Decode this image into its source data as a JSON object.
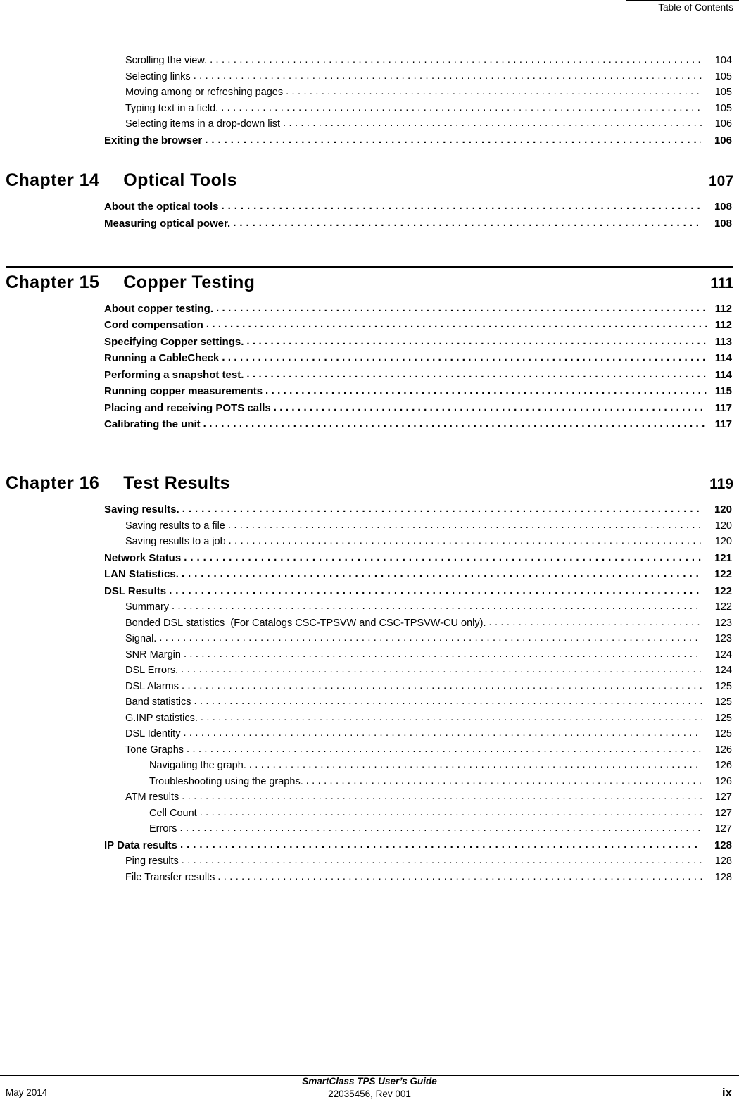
{
  "header": {
    "title": "Table of Contents"
  },
  "footer": {
    "date": "May 2014",
    "guide_title": "SmartClass TPS User’s Guide",
    "doc_number": "22035456, Rev 001",
    "page_number": "ix"
  },
  "toc": {
    "top_entries": [
      {
        "label": "Scrolling the view.",
        "page": "104",
        "level": "sub"
      },
      {
        "label": "Selecting links",
        "page": "105",
        "level": "sub"
      },
      {
        "label": "Moving among or refreshing pages",
        "page": "105",
        "level": "sub"
      },
      {
        "label": "Typing text in a field.",
        "page": "105",
        "level": "sub"
      },
      {
        "label": "Selecting items in a drop-down list",
        "page": "106",
        "level": "sub"
      },
      {
        "label": "Exiting the browser",
        "page": "106",
        "level": "section"
      }
    ],
    "chapters": [
      {
        "number": "Chapter 14",
        "title": "Optical Tools",
        "page": "107",
        "tight": false,
        "entries": [
          {
            "label": "About the optical tools",
            "page": "108",
            "level": "section"
          },
          {
            "label": "Measuring optical power.",
            "page": "108",
            "level": "section"
          }
        ]
      },
      {
        "number": "Chapter 15",
        "title": "Copper Testing",
        "page": "111",
        "tight": true,
        "entries": [
          {
            "label": "About copper testing.",
            "page": "112",
            "level": "section"
          },
          {
            "label": "Cord compensation",
            "page": "112",
            "level": "section"
          },
          {
            "label": "Specifying Copper settings.",
            "page": "113",
            "level": "section"
          },
          {
            "label": "Running a CableCheck",
            "page": "114",
            "level": "section"
          },
          {
            "label": "Performing a snapshot test.",
            "page": "114",
            "level": "section"
          },
          {
            "label": "Running copper measurements",
            "page": "115",
            "level": "section"
          },
          {
            "label": "Placing and receiving POTS calls",
            "page": "117",
            "level": "section"
          },
          {
            "label": "Calibrating the unit",
            "page": "117",
            "level": "section"
          }
        ]
      },
      {
        "number": "Chapter 16",
        "title": "Test Results",
        "page": "119",
        "tight": false,
        "entries": [
          {
            "label": "Saving results.",
            "page": "120",
            "level": "section"
          },
          {
            "label": "Saving results to a file",
            "page": "120",
            "level": "sub"
          },
          {
            "label": "Saving results to a job",
            "page": "120",
            "level": "sub"
          },
          {
            "label": "Network Status",
            "page": "121",
            "level": "section"
          },
          {
            "label": "LAN Statistics.",
            "page": "122",
            "level": "section"
          },
          {
            "label": "DSL Results",
            "page": "122",
            "level": "section"
          },
          {
            "label": "Summary",
            "page": "122",
            "level": "sub"
          },
          {
            "label": "Bonded DSL statistics  (For Catalogs CSC-TPSVW and CSC-TPSVW-CU only).",
            "page": "123",
            "level": "sub"
          },
          {
            "label": "Signal.",
            "page": "123",
            "level": "sub"
          },
          {
            "label": "SNR Margin",
            "page": "124",
            "level": "sub"
          },
          {
            "label": "DSL Errors.",
            "page": "124",
            "level": "sub"
          },
          {
            "label": "DSL Alarms",
            "page": "125",
            "level": "sub"
          },
          {
            "label": "Band statistics",
            "page": "125",
            "level": "sub"
          },
          {
            "label": "G.INP statistics.",
            "page": "125",
            "level": "sub"
          },
          {
            "label": "DSL Identity",
            "page": "125",
            "level": "sub"
          },
          {
            "label": "Tone Graphs",
            "page": "126",
            "level": "sub"
          },
          {
            "label": "Navigating the graph.",
            "page": "126",
            "level": "subsub"
          },
          {
            "label": "Troubleshooting using the graphs.",
            "page": "126",
            "level": "subsub"
          },
          {
            "label": "ATM results",
            "page": "127",
            "level": "sub"
          },
          {
            "label": "Cell Count",
            "page": "127",
            "level": "subsub"
          },
          {
            "label": "Errors",
            "page": "127",
            "level": "subsub"
          },
          {
            "label": "IP Data results",
            "page": "128",
            "level": "section"
          },
          {
            "label": "Ping results",
            "page": "128",
            "level": "sub"
          },
          {
            "label": "File Transfer results",
            "page": "128",
            "level": "sub"
          }
        ]
      }
    ]
  }
}
